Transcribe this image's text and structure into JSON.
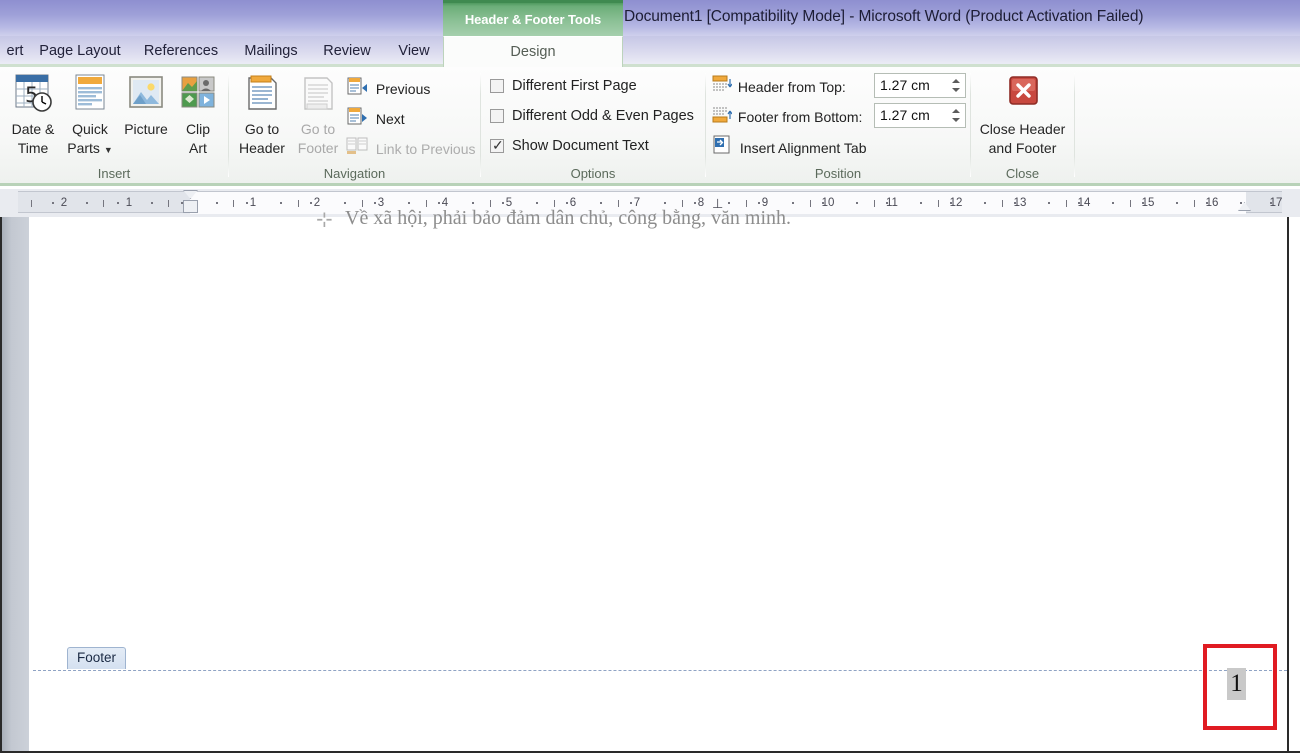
{
  "window": {
    "title": "Document1 [Compatibility Mode]  -  Microsoft Word (Product Activation Failed)",
    "contextual_tools": "Header & Footer Tools"
  },
  "tabs": [
    {
      "label": "ert",
      "active": false,
      "name": "tab-insert"
    },
    {
      "label": "Page Layout",
      "active": false,
      "name": "tab-page-layout"
    },
    {
      "label": "References",
      "active": false,
      "name": "tab-references"
    },
    {
      "label": "Mailings",
      "active": false,
      "name": "tab-mailings"
    },
    {
      "label": "Review",
      "active": false,
      "name": "tab-review"
    },
    {
      "label": "View",
      "active": false,
      "name": "tab-view"
    },
    {
      "label": "Design",
      "active": true,
      "name": "tab-design"
    }
  ],
  "ribbon": {
    "groups": {
      "insert": {
        "label": "Insert",
        "buttons": [
          {
            "line1": "Date &",
            "line2": "Time",
            "icon": "date-time-icon"
          },
          {
            "line1": "Quick",
            "line2": "Parts",
            "icon": "quick-parts-icon",
            "dropdown": true
          },
          {
            "line1": "Picture",
            "line2": "",
            "icon": "picture-icon"
          },
          {
            "line1": "Clip",
            "line2": "Art",
            "icon": "clip-art-icon"
          }
        ]
      },
      "navigation": {
        "label": "Navigation",
        "buttons": [
          {
            "line1": "Go to",
            "line2": "Header",
            "icon": "go-to-header-icon",
            "disabled": false
          },
          {
            "line1": "Go to",
            "line2": "Footer",
            "icon": "go-to-footer-icon",
            "disabled": true
          }
        ],
        "items": [
          {
            "label": "Previous",
            "icon": "previous-section-icon",
            "disabled": false
          },
          {
            "label": "Next",
            "icon": "next-section-icon",
            "disabled": false
          },
          {
            "label": "Link to Previous",
            "icon": "link-to-previous-icon",
            "disabled": true
          }
        ]
      },
      "options": {
        "label": "Options",
        "checkboxes": [
          {
            "label": "Different First Page",
            "checked": false
          },
          {
            "label": "Different Odd & Even Pages",
            "checked": false
          },
          {
            "label": "Show Document Text",
            "checked": true
          }
        ]
      },
      "position": {
        "label": "Position",
        "fields": [
          {
            "label": "Header from Top:",
            "value": "1.27 cm",
            "icon": "header-from-top-icon"
          },
          {
            "label": "Footer from Bottom:",
            "value": "1.27 cm",
            "icon": "footer-from-bottom-icon"
          }
        ],
        "items": [
          {
            "label": "Insert Alignment Tab",
            "icon": "insert-alignment-tab-icon"
          }
        ]
      },
      "close": {
        "label": "Close",
        "button": {
          "line1": "Close Header",
          "line2": "and Footer",
          "icon": "close-header-footer-icon"
        }
      }
    }
  },
  "ruler": {
    "left_labels": [
      "2",
      "1"
    ],
    "right_labels": [
      "1",
      "2",
      "3",
      "4",
      "5",
      "6",
      "7",
      "8",
      "9",
      "10",
      "11",
      "12",
      "13",
      "14",
      "15",
      "16",
      "17"
    ],
    "unit": "cm"
  },
  "document": {
    "body_text": "Về xã hội, phải bảo đảm dân chủ, công bằng, văn minh.",
    "paragraph_mark": "⊹",
    "footer_tag": "Footer",
    "page_number": "1"
  },
  "colors": {
    "titlebar": "#9ea0d8",
    "contextual_tab": "#6cae79",
    "ribbon_accent": "#b8d2b8",
    "highlight_box": "#e01b22",
    "footer_tag": "#d4e0f0"
  }
}
